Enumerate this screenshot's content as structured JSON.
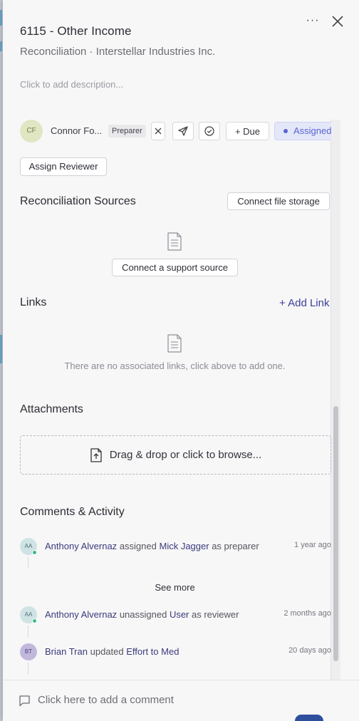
{
  "header": {
    "title": "6115 - Other Income",
    "subtitle": "Reconciliation · Interstellar Industries Inc.",
    "description_placeholder": "Click to add description...",
    "more_label": "···"
  },
  "assignee": {
    "initials": "CF",
    "name": "Connor Fo...",
    "role": "Preparer",
    "due_label": "+ Due",
    "status": "Assigned"
  },
  "assign_reviewer_label": "Assign Reviewer",
  "sources": {
    "title": "Reconciliation Sources",
    "connect_storage_label": "Connect file storage",
    "connect_source_label": "Connect a support source"
  },
  "links": {
    "title": "Links",
    "add_label": "+ Add Link",
    "empty_text": "There are no associated links, click above to add one."
  },
  "attachments": {
    "title": "Attachments",
    "dropzone_label": "Drag & drop or click to browse..."
  },
  "activity": {
    "title": "Comments & Activity",
    "see_more_label": "See more",
    "items": [
      {
        "initials": "AA",
        "actor": "Anthony Alvernaz",
        "verb": "assigned",
        "object": "Mick Jagger",
        "suffix": "as preparer",
        "time": "1 year ago"
      },
      {
        "initials": "AA",
        "actor": "Anthony Alvernaz",
        "verb": "unassigned",
        "object": "User",
        "suffix": "as reviewer",
        "time": "2 months ago"
      },
      {
        "initials": "BT",
        "actor": "Brian Tran",
        "verb": "updated",
        "object": "Effort to Med",
        "suffix": "",
        "time": "20 days ago"
      }
    ]
  },
  "comment_placeholder": "Click here to add a comment",
  "colors": {
    "accent": "#5b63d6",
    "link": "#3b3f9a",
    "online": "#3dbb86"
  }
}
